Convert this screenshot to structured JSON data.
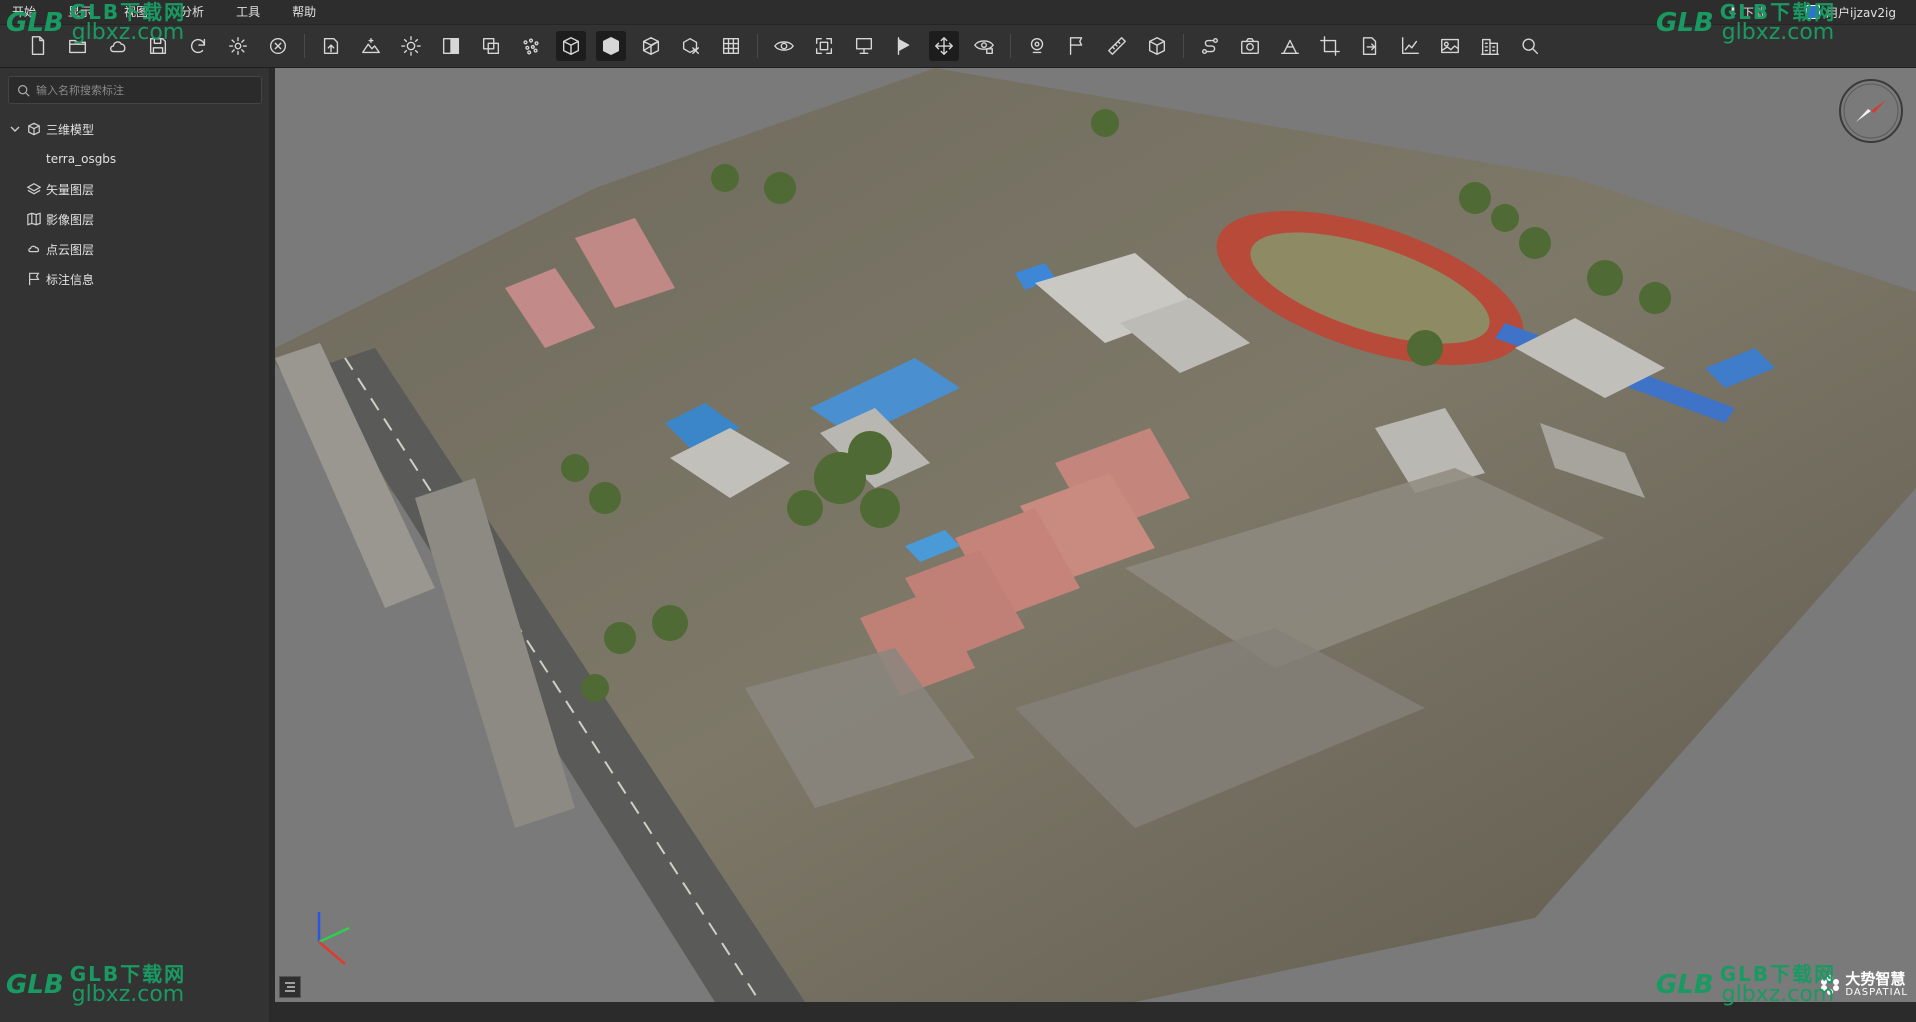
{
  "menu": {
    "items": [
      "开始",
      "显示",
      "视图",
      "分析",
      "工具",
      "帮助"
    ],
    "download_label": "下载",
    "user_label": "用户ijzav2ig"
  },
  "toolbar": {
    "icons": [
      "new-file-icon",
      "open-folder-icon",
      "cloud-icon",
      "save-icon",
      "refresh-icon",
      "settings-icon",
      "close-circle-icon",
      "sep",
      "import-model-icon",
      "terrain-icon",
      "sun-icon",
      "contrast-icon",
      "layers-copy-icon",
      "point-cloud-icon",
      "box-solid-icon",
      "box-filled-icon",
      "box-wire-icon",
      "box-clip-icon",
      "grid-icon",
      "sep",
      "eye-rotate-icon",
      "fullscreen-icon",
      "display-icon",
      "flag-play-icon",
      "move-icon",
      "eye-lock-icon",
      "sep",
      "location-pin-icon",
      "flag-icon",
      "ruler-icon",
      "cube-measure-icon",
      "sep",
      "route-icon",
      "camera-icon",
      "slope-icon",
      "crop-icon",
      "export-file-icon",
      "chart-icon",
      "image-icon",
      "building-icon",
      "search-icon"
    ],
    "active": [
      13,
      14,
      22
    ]
  },
  "sidebar": {
    "search_placeholder": "输入名称搜索标注",
    "tree": [
      {
        "label": "三维模型",
        "icon": "cube-icon",
        "expanded": true
      },
      {
        "label": "terra_osgbs",
        "icon": "",
        "child": true
      },
      {
        "label": "矢量图层",
        "icon": "layers-icon"
      },
      {
        "label": "影像图层",
        "icon": "map-icon"
      },
      {
        "label": "点云图层",
        "icon": "cloud-points-icon"
      },
      {
        "label": "标注信息",
        "icon": "flag-icon"
      }
    ]
  },
  "viewport": {
    "background": "#7a7a7a",
    "brand_cn": "大势智慧",
    "brand_en": "DASPATIAL"
  },
  "watermark": {
    "logo": "GLB",
    "line1": "GLB下载网",
    "line2": "glbxz.com"
  }
}
